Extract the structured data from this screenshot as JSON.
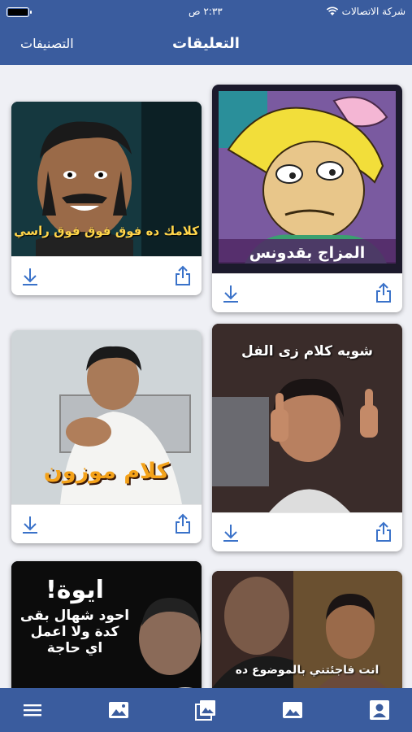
{
  "status_bar": {
    "carrier": "شركة الاتصالات",
    "time": "٢:٣٣ ص"
  },
  "navbar": {
    "title": "التعليقات",
    "left_button": "التصنيفات"
  },
  "cards": [
    {
      "caption": "المزاج بقدونس"
    },
    {
      "caption": "كلامك ده فوق فوق فوق راسي"
    },
    {
      "caption": "شويه كلام زى الفل"
    },
    {
      "caption": "كلام موزون"
    },
    {
      "caption": "انت فاجئتني بالموضوع ده"
    },
    {
      "caption_line1": "ايوة!",
      "caption_line2": "احود شهال بقى",
      "caption_line3": "كدة ولا اعمل",
      "caption_line4": "اي حاجة"
    }
  ],
  "icons": {
    "download": "download-icon",
    "share": "share-icon"
  },
  "tabbar": [
    "menu-icon",
    "image-icon",
    "gallery-icon",
    "image-icon",
    "profile-icon"
  ],
  "colors": {
    "primary": "#3a5c9e",
    "icon": "#3a72c9",
    "background": "#eff0f5"
  }
}
